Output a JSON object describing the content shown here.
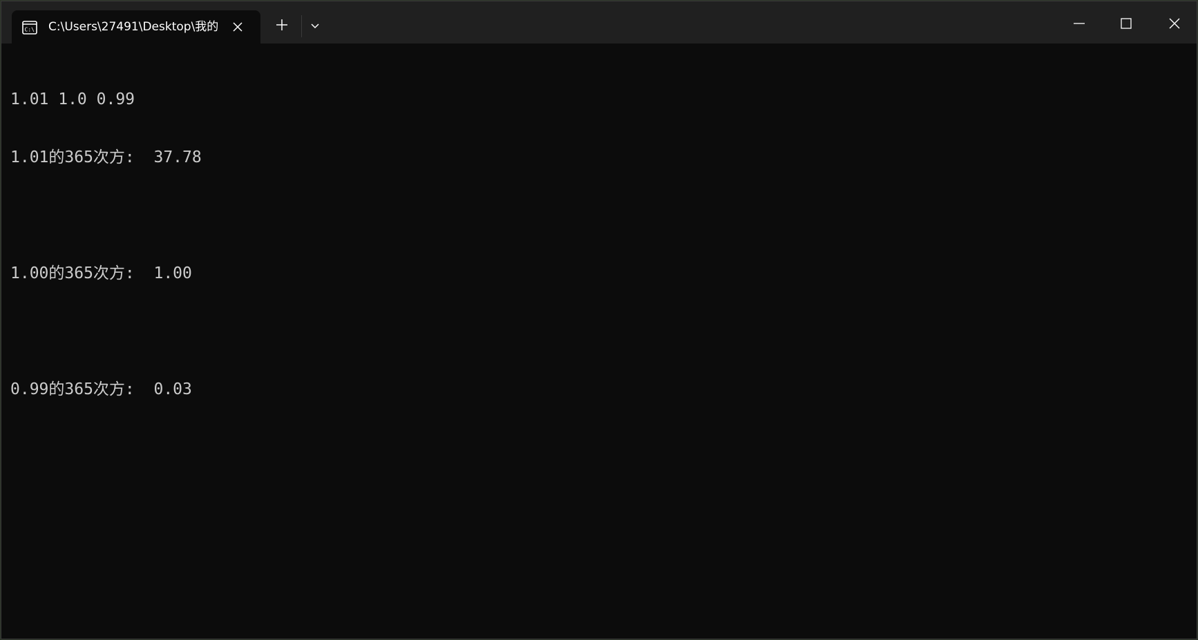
{
  "tab": {
    "title": "C:\\Users\\27491\\Desktop\\我的",
    "icon": "terminal-icon"
  },
  "titlebar": {
    "new_tab_icon": "plus-icon",
    "dropdown_icon": "chevron-down-icon",
    "minimize_icon": "minimize-icon",
    "maximize_icon": "maximize-icon",
    "close_icon": "close-icon"
  },
  "terminal": {
    "lines": [
      "1.01 1.0 0.99",
      "1.01的365次方:  37.78",
      "",
      "1.00的365次方:  1.00",
      "",
      "0.99的365次方:  0.03"
    ]
  },
  "colors": {
    "background": "#0c0c0c",
    "titlebar": "#202020",
    "text": "#cccccc"
  }
}
